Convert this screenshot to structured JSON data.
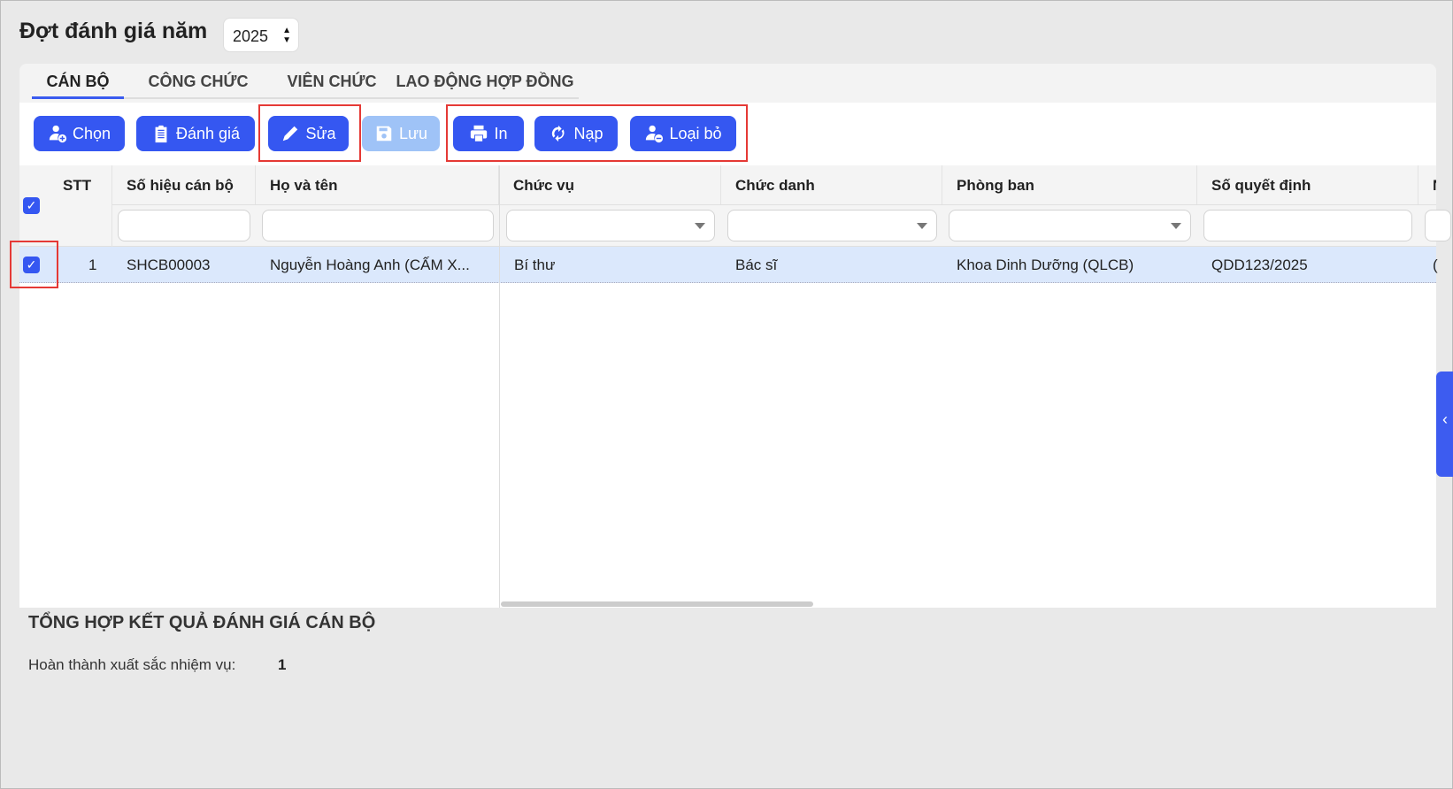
{
  "header": {
    "title": "Đợt đánh giá năm",
    "year": "2025"
  },
  "tabs": [
    {
      "label": "CÁN BỘ"
    },
    {
      "label": "CÔNG CHỨC"
    },
    {
      "label": "VIÊN CHỨC"
    },
    {
      "label": "LAO ĐỘNG HỢP ĐỒNG"
    }
  ],
  "toolbar": {
    "chon": "Chọn",
    "danh_gia": "Đánh giá",
    "sua": "Sửa",
    "luu": "Lưu",
    "in": "In",
    "nap": "Nạp",
    "loai_bo": "Loại bỏ"
  },
  "table": {
    "headers": [
      "STT",
      "Số hiệu cán bộ",
      "Họ và tên",
      "Chức vụ",
      "Chức danh",
      "Phòng ban",
      "Số quyết định",
      "N"
    ],
    "rows": [
      {
        "stt": "1",
        "so_hieu": "SHCB00003",
        "ho_ten": "Nguyễn Hoàng Anh (CẤM X...",
        "chuc_vu": "Bí thư",
        "chuc_danh": "Bác sĩ",
        "phong_ban": "Khoa Dinh Dưỡng (QLCB)",
        "so_qd": "QDD123/2025",
        "extra": "("
      }
    ]
  },
  "summary": {
    "title": "TỔNG HỢP KẾT QUẢ ĐÁNH GIÁ CÁN BỘ",
    "label": "Hoàn thành xuất sắc nhiệm vụ:",
    "value": "1"
  },
  "colors": {
    "accent": "#3557f1",
    "selected_row": "#dbe8fc",
    "highlight": "#e53935"
  }
}
